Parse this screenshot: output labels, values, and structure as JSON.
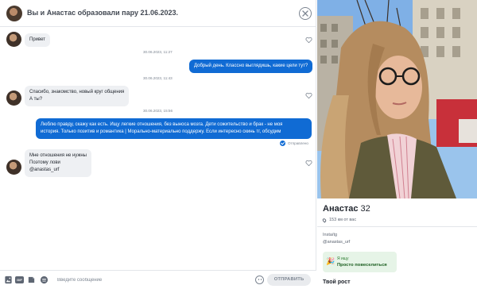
{
  "header": {
    "title": "Вы и Анастас образовали пару 21.06.2023."
  },
  "messages": [
    {
      "direction": "in",
      "lines": [
        "Привет"
      ]
    },
    {
      "timestamp": "30.06.2023, 11:27",
      "direction": "out",
      "lines": [
        "Добрый день. Классно выглядишь, какие цели тут?"
      ]
    },
    {
      "timestamp": "30.06.2023, 11:43",
      "direction": "in",
      "lines": [
        "Спасибо, знакомство, новый круг общения",
        "А ты?"
      ]
    },
    {
      "timestamp": "30.06.2023, 15:56",
      "direction": "out",
      "lines": [
        "Люблю правду, скажу как есть. Ищу легкие отношения, без выноса мозга. Дети сожительство и брак - не моя",
        "история. Только позитив и романтика | Морально-материально поддержу. Если интересно скинь тг, обсудим"
      ],
      "status": "Отправлено"
    },
    {
      "direction": "in",
      "lines": [
        "Мне отношения не нужны",
        "Поэтому лови",
        "@anastas_urf"
      ]
    }
  ],
  "composer": {
    "placeholder": "Введите сообщение",
    "gif_label": "GIF",
    "send_label": "ОТПРАВИТЬ"
  },
  "profile": {
    "name": "Анастас",
    "age": "32",
    "distance": "153 км от вас",
    "bio_lines": [
      "Insta/tg",
      "@anastas_urf"
    ],
    "goal_label": "Я ищу",
    "goal_value": "Просто повеселиться",
    "goal_emoji": "🎉",
    "section_height": "Твой рост"
  },
  "icons": {
    "close": "close-circle-icon",
    "heart": "heart-outline-icon",
    "pin": "location-pin-icon",
    "sent": "sent-check-icon",
    "emoji": "emoji-smile-icon",
    "image": "image-upload-icon",
    "sticker": "sticker-icon",
    "music": "music-icon"
  },
  "colors": {
    "accent": "#106bd4",
    "bubble_in": "#eef0f3",
    "goal_bg": "#e6f4e7",
    "goal_text": "#1b5e20"
  }
}
